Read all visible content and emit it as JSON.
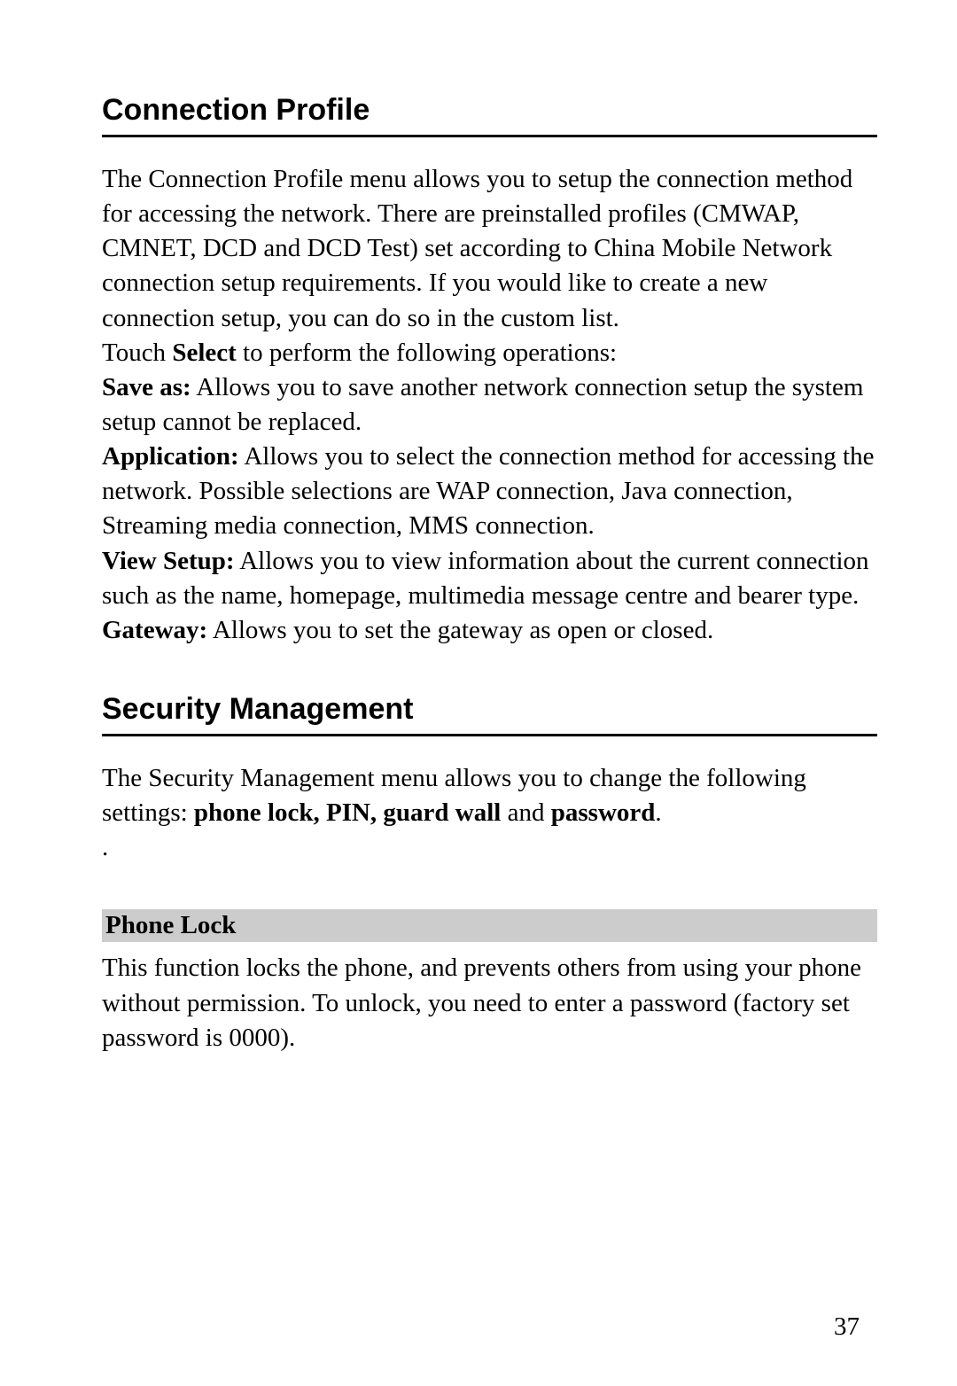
{
  "page_number": "37",
  "section1": {
    "heading": "Connection Profile",
    "intro": "The Connection Profile menu allows you to setup the connection method for accessing the network. There are preinstalled profiles (CMWAP, CMNET, DCD and DCD Test) set according to China Mobile Network connection setup requirements. If you would like to create a new connection setup, you can do so in the custom list.",
    "touch_prefix": "Touch ",
    "touch_bold": "Select",
    "touch_suffix": " to perform the following operations:",
    "saveas_label": "Save as:",
    "saveas_text": " Allows you to save another network connection setup the system setup cannot be replaced.",
    "application_label": "Application:",
    "application_text": " Allows you to select the connection method for accessing the network. Possible selections are WAP connection, Java connection, Streaming media connection, MMS connection.",
    "viewsetup_label": "View Setup:",
    "viewsetup_text": " Allows you to view information about the current connection such as the name, homepage, multimedia message centre and bearer type.",
    "gateway_label": "Gateway:",
    "gateway_text": " Allows you to set the gateway as open or closed."
  },
  "section2": {
    "heading": "Security Management",
    "intro_prefix": "The Security Management menu allows you to change the following settings: ",
    "intro_bold": "phone lock, PIN, guard wall",
    "intro_mid": " and ",
    "intro_bold2": "password",
    "intro_suffix": ".",
    "dot": ".",
    "phonelock_heading": "Phone Lock",
    "phonelock_text": "This function locks the phone, and prevents others from using your phone without permission. To unlock, you need to enter a password (factory set password is 0000)."
  }
}
